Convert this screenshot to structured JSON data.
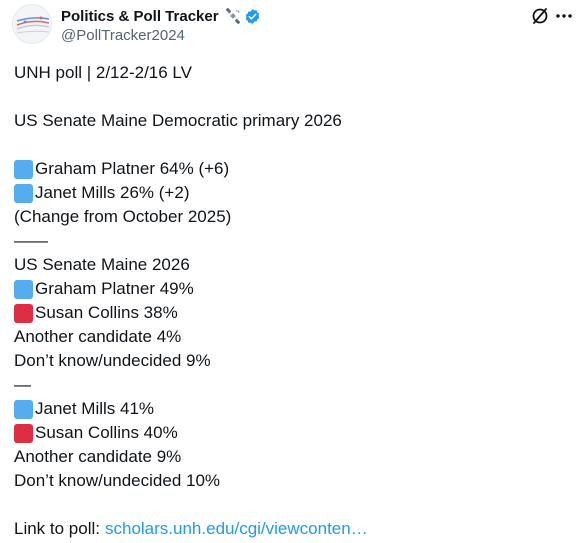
{
  "author": {
    "display_name": "Politics & Poll Tracker",
    "handle": "@PollTracker2024",
    "badge_icon": "satellite-icon",
    "verified_icon": "verified-badge-icon",
    "verified_color": "#1d9bf0"
  },
  "actions": {
    "grok_icon": "grok-icon",
    "more_icon": "more-icon"
  },
  "tweet": {
    "poll_header": "UNH poll | 2/12-2/16 LV",
    "primary_title": "US Senate Maine Democratic primary 2026",
    "primary": [
      {
        "color": "blue",
        "text": "Graham Platner 64% (+6)"
      },
      {
        "color": "blue",
        "text": "Janet Mills 26% (+2)"
      }
    ],
    "change_note": "(Change from October 2025)",
    "divider_long": "——",
    "general_title": "US Senate Maine 2026",
    "general_a": [
      {
        "color": "blue",
        "text": "Graham Platner 49%"
      },
      {
        "color": "red",
        "text": "Susan Collins 38%"
      }
    ],
    "general_a_other": "Another candidate 4%",
    "general_a_undecided": "Don’t know/undecided 9%",
    "divider_short": "—",
    "general_b": [
      {
        "color": "blue",
        "text": "Janet Mills 41%"
      },
      {
        "color": "red",
        "text": "Susan Collins 40%"
      }
    ],
    "general_b_other": "Another candidate 9%",
    "general_b_undecided": "Don’t know/undecided 10%",
    "link_label": "Link to poll:",
    "link_text": "scholars.unh.edu/cgi/viewconten…"
  },
  "colors": {
    "blue_square": "#55acee",
    "red_square": "#dd2e44",
    "link": "#1d9bf0"
  }
}
